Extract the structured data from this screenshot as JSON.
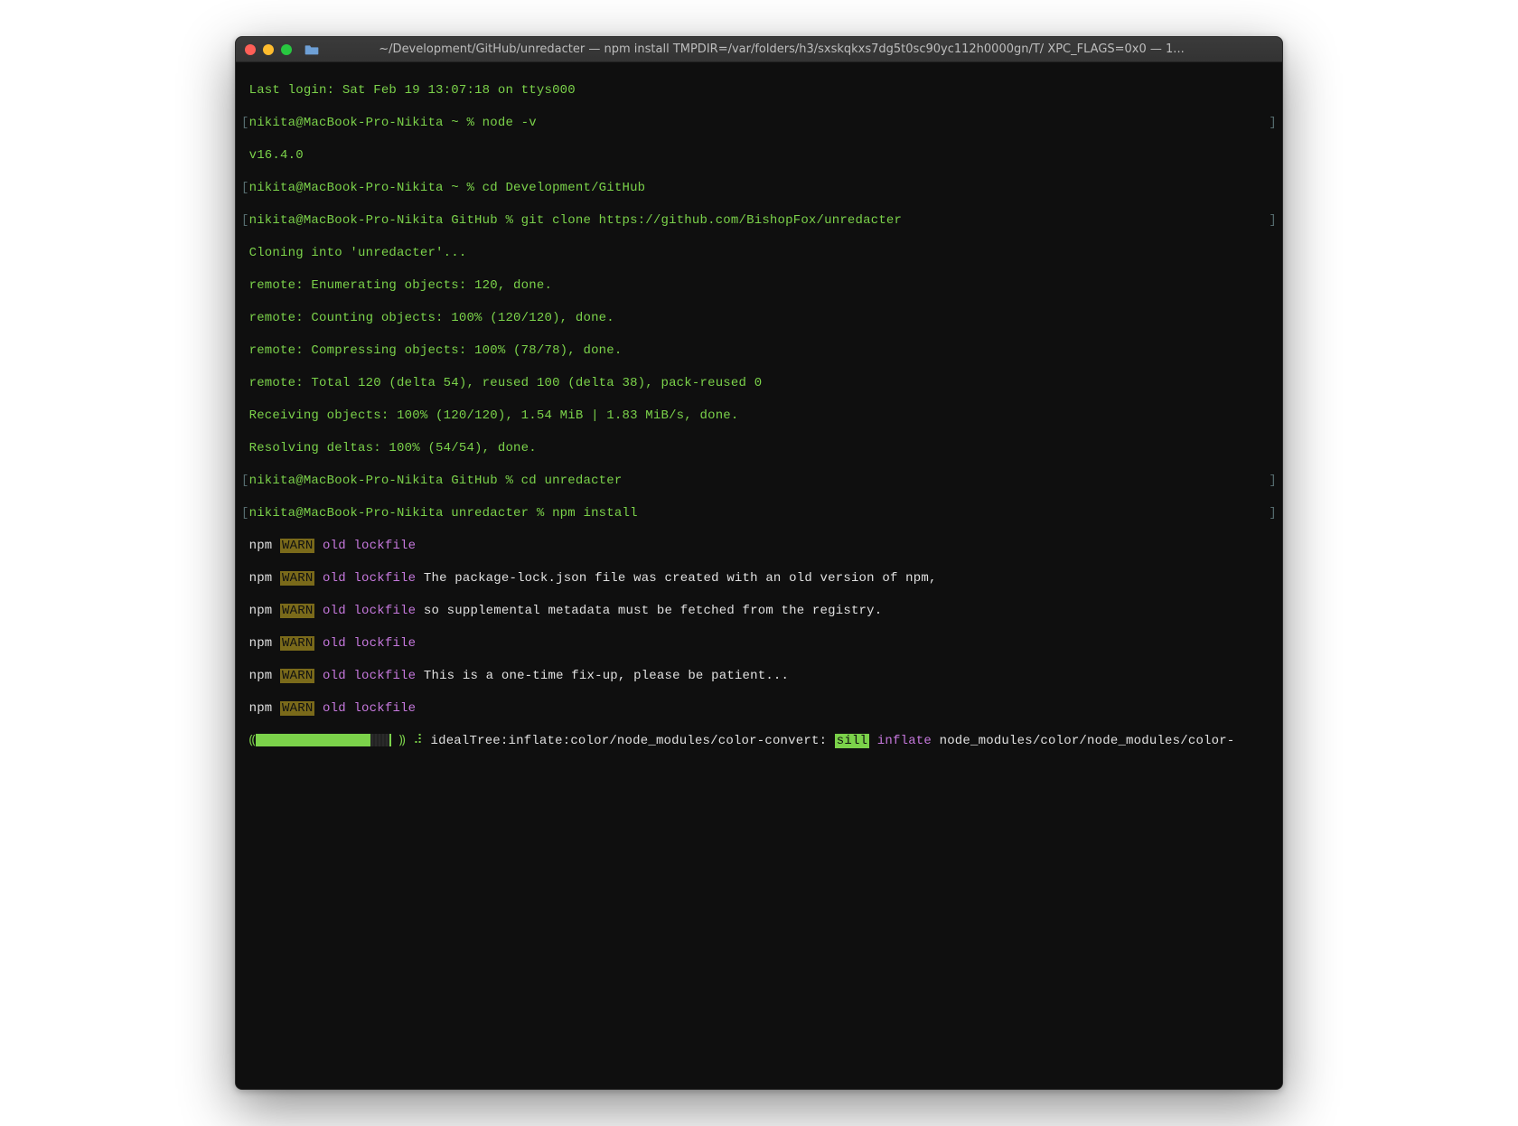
{
  "titlebar": {
    "title": "~/Development/GitHub/unredacter — npm install TMPDIR=/var/folders/h3/sxskqkxs7dg5t0sc90yc112h0000gn/T/ XPC_FLAGS=0x0 — 1..."
  },
  "term": {
    "last_login": "Last login: Sat Feb 19 13:07:18 on ttys000",
    "p1_prompt": "nikita@MacBook-Pro-Nikita ~ % ",
    "p1_cmd": "node -v",
    "node_version": "v16.4.0",
    "p2_prompt": "nikita@MacBook-Pro-Nikita ~ % ",
    "p2_cmd": "cd Development/GitHub",
    "p3_prompt": "nikita@MacBook-Pro-Nikita GitHub % ",
    "p3_cmd": "git clone https://github.com/BishopFox/unredacter",
    "clone1": "Cloning into 'unredacter'...",
    "clone2": "remote: Enumerating objects: 120, done.",
    "clone3": "remote: Counting objects: 100% (120/120), done.",
    "clone4": "remote: Compressing objects: 100% (78/78), done.",
    "clone5": "remote: Total 120 (delta 54), reused 100 (delta 38), pack-reused 0",
    "clone6": "Receiving objects: 100% (120/120), 1.54 MiB | 1.83 MiB/s, done.",
    "clone7": "Resolving deltas: 100% (54/54), done.",
    "p4_prompt": "nikita@MacBook-Pro-Nikita GitHub % ",
    "p4_cmd": "cd unredacter",
    "p5_prompt": "nikita@MacBook-Pro-Nikita unredacter % ",
    "p5_cmd": "npm install",
    "npm": "npm",
    "warn": "WARN",
    "old_lockfile": " old lockfile",
    "w2_msg": " The package-lock.json file was created with an old version of npm,",
    "w3_msg": " so supplemental metadata must be fetched from the registry.",
    "w5_msg": " This is a one-time fix-up, please be patient...",
    "spinner_sep": " ⸩ ⠼ ",
    "progress_label": "idealTree:inflate:color/node_modules/color-convert:",
    "sill": "sill",
    "inflate": " inflate ",
    "inflate_path": "node_modules/color/node_modules/color-",
    "lbracket": "[",
    "rbracket": "]",
    "lparen": "⸨"
  }
}
